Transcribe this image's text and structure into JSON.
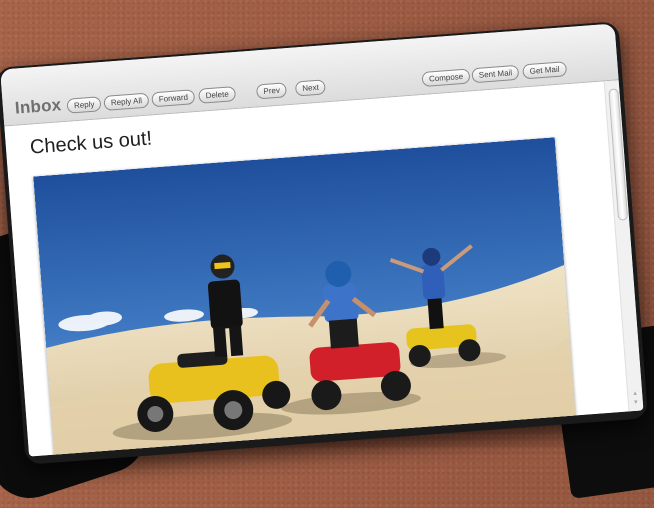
{
  "mail": {
    "folder_title": "Inbox",
    "toolbar": {
      "reply": "Reply",
      "reply_all": "Reply All",
      "forward": "Forward",
      "delete": "Delete",
      "prev": "Prev",
      "next": "Next",
      "compose": "Compose",
      "sent_mail": "Sent Mail",
      "get_mail": "Get Mail"
    },
    "message": {
      "subject": "Check us out!"
    }
  }
}
